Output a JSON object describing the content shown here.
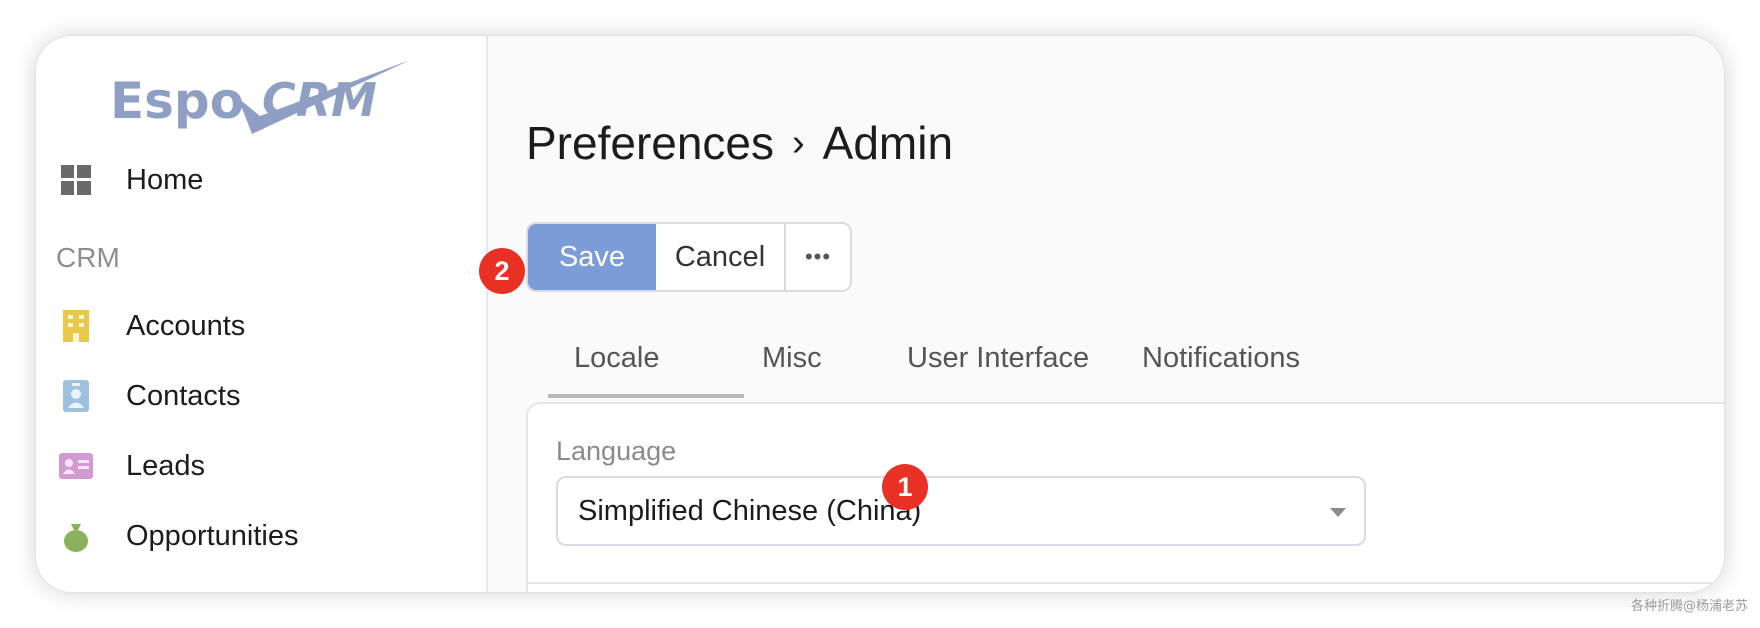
{
  "app": {
    "logo_text": "EspoCRM"
  },
  "sidebar": {
    "home": {
      "label": "Home",
      "icon": "dashboard-icon"
    },
    "group_label": "CRM",
    "items": [
      {
        "label": "Accounts",
        "icon": "building-icon",
        "color": "#e9c74a"
      },
      {
        "label": "Contacts",
        "icon": "id-badge-icon",
        "color": "#9fc1e0"
      },
      {
        "label": "Leads",
        "icon": "id-card-icon",
        "color": "#d29ad0"
      },
      {
        "label": "Opportunities",
        "icon": "money-bag-icon",
        "color": "#8ab25a"
      }
    ]
  },
  "header": {
    "title_part1": "Preferences",
    "separator": "›",
    "title_part2": "Admin"
  },
  "toolbar": {
    "save_label": "Save",
    "cancel_label": "Cancel",
    "more_label": "•••",
    "save_color": "#7b9cd7"
  },
  "tabs": [
    {
      "label": "Locale",
      "active": true
    },
    {
      "label": "Misc",
      "active": false
    },
    {
      "label": "User Interface",
      "active": false
    },
    {
      "label": "Notifications",
      "active": false
    }
  ],
  "locale_panel": {
    "language_label": "Language",
    "language_value": "Simplified Chinese (China)"
  },
  "annotations": {
    "badge_1": "1",
    "badge_2": "2",
    "badge_color": "#e83025"
  },
  "watermark": "各种折腾@杨浦老苏"
}
